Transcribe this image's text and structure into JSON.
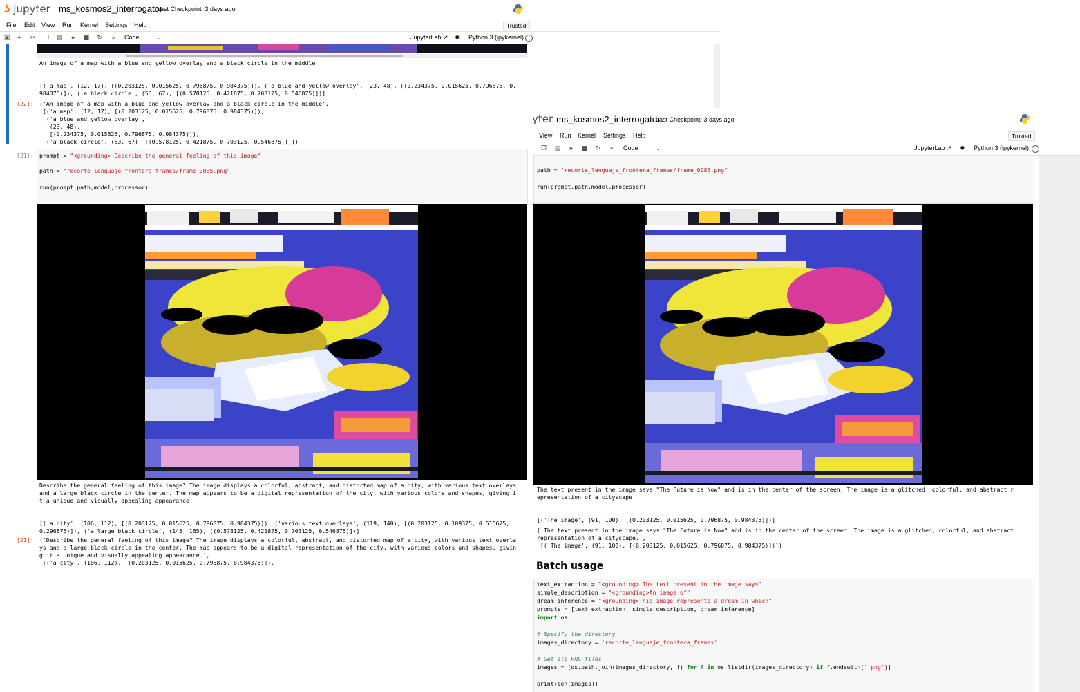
{
  "left_window": {
    "app_name": "jupyter",
    "notebook_name": "ms_kosmos2_interrogator",
    "checkpoint": "Last Checkpoint: 3 days ago",
    "menu": [
      "File",
      "Edit",
      "View",
      "Run",
      "Kernel",
      "Settings",
      "Help"
    ],
    "trusted": "Trusted",
    "cell_type": "Code",
    "jupyterlab_link": "JupyterLab",
    "kernel": "Python 3 (ipykernel)",
    "cells": {
      "prev_output_caption": "An image of a map with a blue and yellow overlay and a black circle in the middle",
      "prev_output_entities": [
        "[('a map', (12, 17), [(0.203125, 0.015625, 0.796875, 0.984375)]), ('a blue and yellow overlay', (23, 48), [(0.234375, 0.015625, 0.796875, 0.",
        "984375)]), ('a black circle', (53, 67), [(0.578125, 0.421875, 0.703125, 0.546875)])]"
      ],
      "out22_prompt": "[22]:",
      "out22_lines": [
        "('An image of a map with a blue and yellow overlay and a black circle in the middle',",
        " [('a map', (12, 17), [(0.203125, 0.015625, 0.796875, 0.984375)]),",
        "  ('a blue and yellow overlay',",
        "   (23, 48),",
        "   [(0.234375, 0.015625, 0.796875, 0.984375)]),",
        "  ('a black circle', (53, 67), [(0.578125, 0.421875, 0.703125, 0.546875)])])"
      ],
      "in21_prompt": "[21]:",
      "in21_prompt_var": "prompt",
      "in21_prompt_eq": " = ",
      "in21_prompt_str": "\"<grounding> Describe the general feeling of this image\"",
      "in21_path_var": "path",
      "in21_path_eq": " = ",
      "in21_path_str": "\"recorte_lenguaje_frontera_frames/frame_0085.png\"",
      "in21_run": "run(prompt,path,model,processor)",
      "out21_text_lines": [
        "Describe the general feeling of this image? The image displays a colorful, abstract, and distorted map of a city, with various text overlays",
        "and a large black circle in the center. The map appears to be a digital representation of the city, with various colors and shapes, giving i",
        "t a unique and visually appealing appearance."
      ],
      "out21_entities": [
        "[('a city', (106, 112), [(0.203125, 0.015625, 0.796875, 0.984375)]), ('various text overlays', (119, 140), [(0.203125, 0.109375, 0.515625,",
        "0.296875)]), ('a large black circle', (145, 165), [(0.578125, 0.421875, 0.703125, 0.546875)])]"
      ],
      "out21_prompt": "[21]:",
      "out21_lines": [
        "('Describe the general feeling of this image? The image displays a colorful, abstract, and distorted map of a city, with various text overla",
        "ys and a large black circle in the center. The map appears to be a digital representation of the city, with various colors and shapes, givin",
        "g it a unique and visually appealing appearance.',",
        " [('a city', (106, 112), [(0.203125, 0.015625, 0.796875, 0.984375)]),"
      ]
    }
  },
  "right_window": {
    "app_name": "yter",
    "notebook_name": "ms_kosmos2_interrogator",
    "checkpoint": "Last Checkpoint: 3 days ago",
    "menu": [
      "View",
      "Run",
      "Kernel",
      "Settings",
      "Help"
    ],
    "trusted": "Trusted",
    "cell_type": "Code",
    "jupyterlab_link": "JupyterLab",
    "kernel": "Python 3 (ipykernel)",
    "cells": {
      "path_var": "path",
      "path_eq": " = ",
      "path_str": "\"recorte_lenguaje_frontera_frames/frame_0085.png\"",
      "run": "run(prompt,path,model,processor)",
      "output_text_lines": [
        "The text present in the image says \"The Future is Now\" and is in the center of the screen. The image is a glitched, colorful, and abstract r",
        "epresentation of a cityscape."
      ],
      "output_entities": "[('The image', (91, 100), [(0.203125, 0.015625, 0.796875, 0.984375)])]",
      "output_repr_lines": [
        "('The text present in the image says \"The Future is Now\" and is in the center of the screen. The image is a glitched, colorful, and abstract",
        "representation of a cityscape.',",
        " [('The image', (91, 100), [(0.203125, 0.015625, 0.796875, 0.984375)])])"
      ],
      "section_heading": "Batch usage",
      "batch": {
        "text_extraction_var": "text_extraction",
        "text_extraction_str": "\"<grounding> The text present in the image says\"",
        "simple_description_var": "simple_description",
        "simple_description_str": "\"<grounding>An image of\"",
        "dream_inference_var": "dream_inference",
        "dream_inference_str": "\"<grounding>This image represents a dream in which\"",
        "prompts_line": "prompts = [text_extraction, simple_description, dream_inference]",
        "import_kw": "import",
        "import_mod": " os",
        "comment1": "# Specify the directory",
        "images_dir_var": "images_directory",
        "images_dir_str": "'recorte_lenguaje_frontera_frames'",
        "comment2": "# Get all PNG files",
        "images_line_a": "images = [os.path.join(images_directory, f) ",
        "images_kw_for": "for",
        "images_line_b": " f ",
        "images_kw_in": "in",
        "images_line_c": " os.listdir(images_directory) ",
        "images_kw_if": "if",
        "images_line_d": " f.endswith(",
        "images_str": "'.png'",
        "images_line_e": ")]",
        "print_line": "print(len(images))"
      }
    }
  },
  "colors": {
    "accent_orange": "#f37626",
    "selected_cell_bar": "#1e6ec9",
    "output_prompt": "#d84315",
    "string": "#ba2121",
    "keyword": "#008000",
    "comment": "#408080"
  }
}
